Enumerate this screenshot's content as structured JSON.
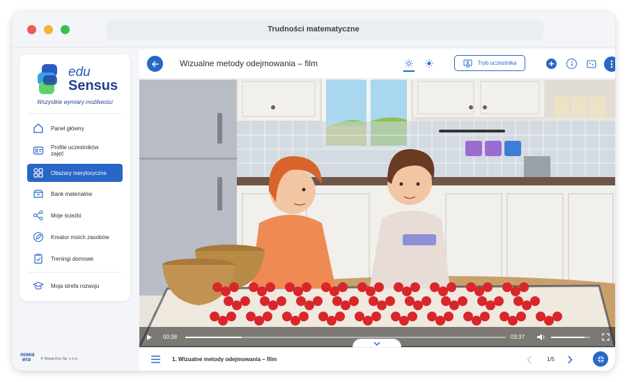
{
  "window": {
    "title": "Trudności matematyczne"
  },
  "brand": {
    "edu": "edu",
    "sensus": "Sensus",
    "tagline": "Wszystkie wymiary możliwości"
  },
  "sidebar": {
    "items": [
      {
        "label": "Panel główny",
        "icon": "home-icon"
      },
      {
        "label": "Profile uczestników zajęć",
        "icon": "id-card-icon"
      },
      {
        "label": "Obszary merytoryczne",
        "icon": "grid-icon",
        "active": true
      },
      {
        "label": "Bank materiałów",
        "icon": "archive-icon"
      },
      {
        "label": "Moje ścieżki",
        "icon": "share-icon"
      },
      {
        "label": "Kreator moich zasobów",
        "icon": "edit-icon"
      },
      {
        "label": "Treningi domowe",
        "icon": "clipboard-icon"
      },
      {
        "label": "Moja strefa rozwoju",
        "icon": "graduation-cap-icon"
      }
    ]
  },
  "footer": {
    "logo_line1": "nowa",
    "logo_line2": "era",
    "copyright": "© Nowa Era Sp. z o.o."
  },
  "header": {
    "title": "Wizualne metody odejmowania – film",
    "mode_button": "Tryb uczestnika"
  },
  "player": {
    "current_time": "00:38",
    "duration": "03:37",
    "progress": 0.175,
    "volume": 0.85
  },
  "bottom": {
    "playlist_title": "1. Wizualne metody odejmowania – film",
    "page_indicator": "1/5"
  },
  "colors": {
    "accent": "#2867c7",
    "active_nav": "#2867c7"
  }
}
